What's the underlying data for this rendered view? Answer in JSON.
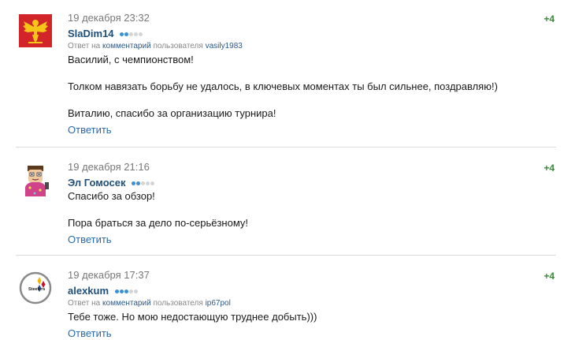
{
  "colors": {
    "author": "#1f4e79",
    "link": "#2a6aa8",
    "rating_positive": "#3a8a3a",
    "rank_dot_active": "#3b8fd6",
    "rank_dot_inactive": "#d4d4d4"
  },
  "comments": [
    {
      "date": "19 декабря 23:32",
      "rating": "+4",
      "author": "SlaDim14",
      "avatar": "coat-of-arms-icon",
      "rank_dots_active": 2,
      "rank_dots_total": 5,
      "reply_prefix": "Ответ на",
      "reply_link": "комментарий",
      "reply_middle": "пользователя",
      "reply_user": "vasily1983",
      "text": [
        "Василий, с чемпионством!",
        "Толком навязать борьбу не удалось, в ключевых моментах ты был сильнее, поздравляю!)",
        "Виталию, спасибо за организацию турнира!"
      ],
      "reply_button": "Ответить"
    },
    {
      "date": "19 декабря 21:16",
      "rating": "+4",
      "author": "Эл Гомосек",
      "avatar": "cartoon-character-icon",
      "rank_dots_active": 2,
      "rank_dots_total": 5,
      "text": [
        "Спасибо за обзор!",
        "Пора браться за дело по-серьёзному!"
      ],
      "reply_button": "Ответить"
    },
    {
      "date": "19 декабря 17:37",
      "rating": "+4",
      "author": "alexkum",
      "avatar": "steelers-logo-icon",
      "avatar_label": "Steelers",
      "rank_dots_active": 3,
      "rank_dots_total": 5,
      "reply_prefix": "Ответ на",
      "reply_link": "комментарий",
      "reply_middle": "пользователя",
      "reply_user": "ip67pol",
      "text": [
        "Тебе тоже. Но мою недостающую труднее добыть)))"
      ],
      "reply_button": "Ответить"
    }
  ]
}
